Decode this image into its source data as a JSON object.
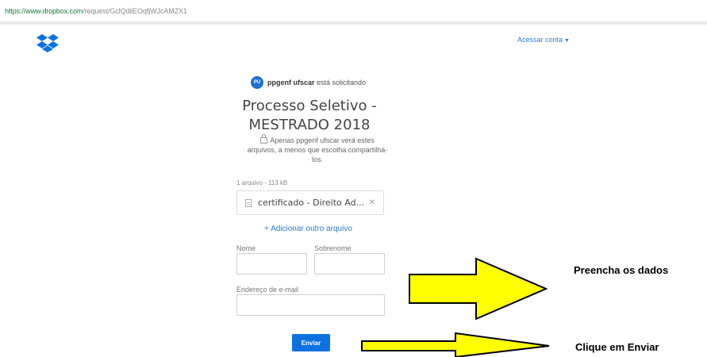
{
  "browser": {
    "url_host": "https://www.dropbox.com",
    "url_path": "/request/GclQdilEOqfjWJcAMZX1"
  },
  "header": {
    "logo_icon": "dropbox-logo-icon",
    "account_label": "Acessar conta"
  },
  "request": {
    "avatar_initials": "PU",
    "requester_name": "ppgenf ufscar",
    "requester_suffix": "está solicitando",
    "title_line1": "Processo Seletivo -",
    "title_line2": "MESTRADO 2018",
    "privacy_line1": "Apenas ppgenf ufscar verá estes",
    "privacy_line2": "arquivos, a menos que escolha compartilhá-",
    "privacy_line3": "los."
  },
  "files": {
    "summary": "1 arquivo - 113 kB",
    "items": [
      {
        "name": "certificado - Direito Ad..."
      }
    ],
    "add_label": "+ Adicionar outro arquivo"
  },
  "form": {
    "first_name_label": "Nome",
    "first_name_value": "",
    "last_name_label": "Sobrenome",
    "last_name_value": "",
    "email_label": "Endereço de e-mail",
    "email_value": "",
    "submit_label": "Enviar"
  },
  "annotations": {
    "fill_note": "Preencha os dados",
    "click_note": "Clique em Enviar",
    "arrow_color": "#ffff00"
  },
  "colors": {
    "accent": "#0d72e0",
    "link": "#2a7bd6"
  }
}
